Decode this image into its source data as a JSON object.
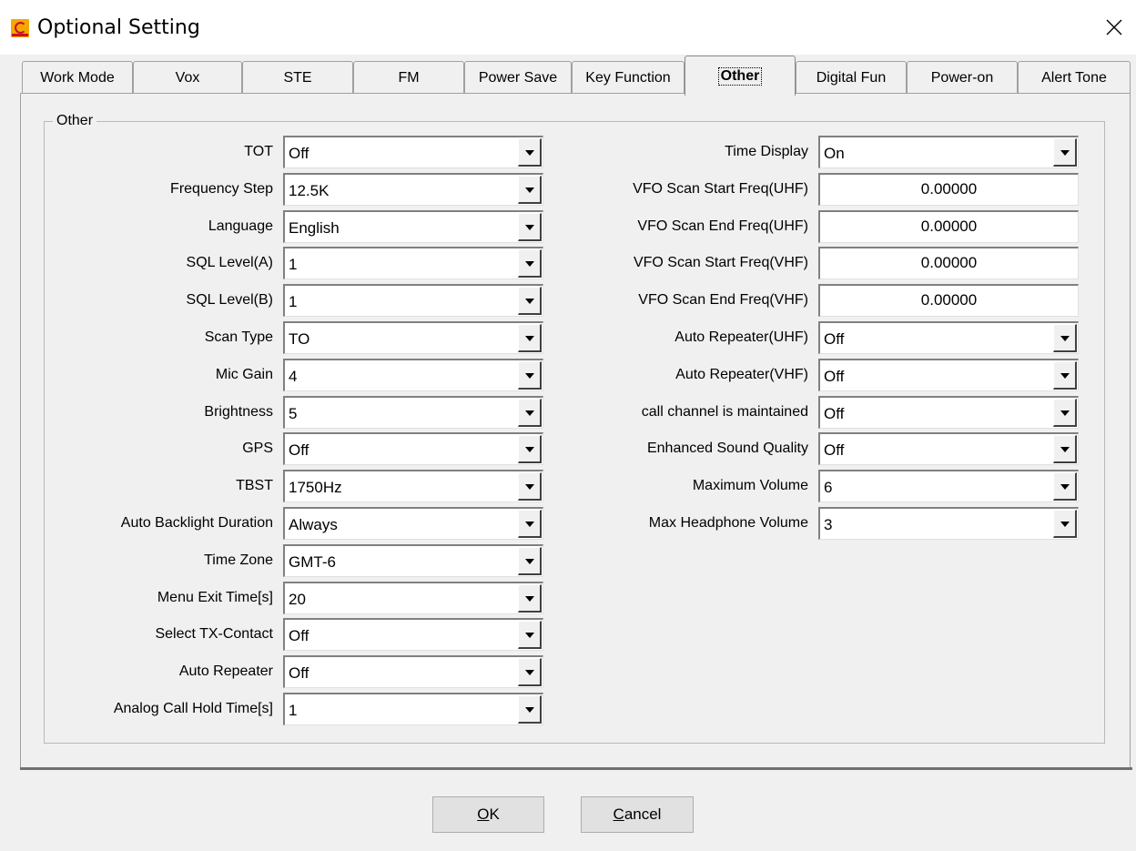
{
  "window": {
    "title": "Optional Setting"
  },
  "tabs": [
    {
      "label": "Work Mode",
      "active": false
    },
    {
      "label": "Vox",
      "active": false
    },
    {
      "label": "STE",
      "active": false
    },
    {
      "label": "FM",
      "active": false
    },
    {
      "label": "Power Save",
      "active": false
    },
    {
      "label": "Key Function",
      "active": false
    },
    {
      "label": "Other",
      "active": true
    },
    {
      "label": "Digital Fun",
      "active": false
    },
    {
      "label": "Power-on",
      "active": false
    },
    {
      "label": "Alert Tone",
      "active": false
    }
  ],
  "group": {
    "title": "Other"
  },
  "left_fields": [
    {
      "label": "TOT",
      "value": "Off"
    },
    {
      "label": "Frequency Step",
      "value": "12.5K"
    },
    {
      "label": "Language",
      "value": "English"
    },
    {
      "label": "SQL Level(A)",
      "value": "1"
    },
    {
      "label": "SQL Level(B)",
      "value": "1"
    },
    {
      "label": "Scan Type",
      "value": "TO"
    },
    {
      "label": "Mic Gain",
      "value": "4"
    },
    {
      "label": "Brightness",
      "value": "5"
    },
    {
      "label": "GPS",
      "value": "Off"
    },
    {
      "label": "TBST",
      "value": "1750Hz"
    },
    {
      "label": "Auto Backlight Duration",
      "value": "Always"
    },
    {
      "label": "Time Zone",
      "value": "GMT-6"
    },
    {
      "label": "Menu Exit Time[s]",
      "value": "20"
    },
    {
      "label": "Select TX-Contact",
      "value": "Off"
    },
    {
      "label": "Auto Repeater",
      "value": "Off"
    },
    {
      "label": "Analog Call Hold Time[s]",
      "value": "1"
    }
  ],
  "right_fields": [
    {
      "label": "Time Display",
      "value": "On",
      "kind": "combo"
    },
    {
      "label": "VFO Scan Start Freq(UHF)",
      "value": "0.00000",
      "kind": "text"
    },
    {
      "label": "VFO Scan End Freq(UHF)",
      "value": "0.00000",
      "kind": "text"
    },
    {
      "label": "VFO Scan Start Freq(VHF)",
      "value": "0.00000",
      "kind": "text"
    },
    {
      "label": "VFO Scan End Freq(VHF)",
      "value": "0.00000",
      "kind": "text"
    },
    {
      "label": "Auto Repeater(UHF)",
      "value": "Off",
      "kind": "combo"
    },
    {
      "label": "Auto Repeater(VHF)",
      "value": "Off",
      "kind": "combo"
    },
    {
      "label": "call channel is maintained",
      "value": "Off",
      "kind": "combo"
    },
    {
      "label": "Enhanced Sound Quality",
      "value": "Off",
      "kind": "combo"
    },
    {
      "label": "Maximum Volume",
      "value": "6",
      "kind": "combo"
    },
    {
      "label": "Max Headphone Volume",
      "value": "3",
      "kind": "combo"
    }
  ],
  "buttons": {
    "ok": {
      "accel": "O",
      "rest": "K"
    },
    "cancel": {
      "accel": "C",
      "rest": "ancel"
    }
  },
  "icons": {
    "app": "app-logo-icon",
    "close": "close-icon",
    "dropdown": "dropdown-arrow-icon"
  }
}
